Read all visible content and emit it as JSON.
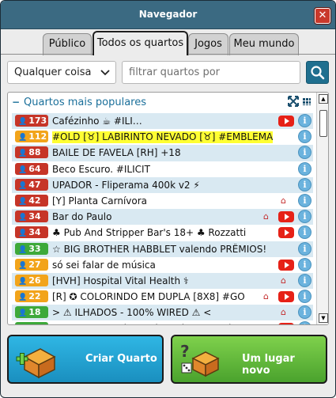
{
  "window": {
    "title": "Navegador",
    "close_label": "✕"
  },
  "tabs": [
    {
      "label": "Público",
      "active": false
    },
    {
      "label": "Todos os quartos",
      "active": true
    },
    {
      "label": "Jogos",
      "active": false
    },
    {
      "label": "Meu mundo",
      "active": false
    }
  ],
  "search": {
    "filter_selected": "Qualquer coisa",
    "placeholder": "filtrar quartos por"
  },
  "section": {
    "title": "Quartos mais populares",
    "collapse_symbol": "−"
  },
  "rooms": [
    {
      "count": "173",
      "status": "red",
      "name": "Cafézinho ☕ #ILI…",
      "youtube": true,
      "house": false
    },
    {
      "count": "112",
      "status": "orange",
      "name": "#OLD [♉] LABIRINTO NEVADO [♉] #EMBLEMA",
      "youtube": false,
      "house": false,
      "highlight": true
    },
    {
      "count": "88",
      "status": "red",
      "name": "BAILE DE FAVELA [RH] +18",
      "youtube": false,
      "house": false
    },
    {
      "count": "64",
      "status": "red",
      "name": "Beco Escuro.          #ILICIT",
      "youtube": false,
      "house": false
    },
    {
      "count": "47",
      "status": "red",
      "name": "UPADOR - Fliperama 400k v2 ⚡",
      "youtube": false,
      "house": false
    },
    {
      "count": "42",
      "status": "red",
      "name": "[Y] Planta Carnívora",
      "youtube": false,
      "house": true
    },
    {
      "count": "34",
      "status": "red",
      "name": "Bar do Paulo",
      "youtube": true,
      "house": true
    },
    {
      "count": "34",
      "status": "red",
      "name": "♣ Pub And Stripper Bar's 18+   ♣ Rozzatti",
      "youtube": true,
      "house": false
    },
    {
      "count": "33",
      "status": "green",
      "name": "☆ BIG BROTHER HABBLET valendo PRÊMIOS!",
      "youtube": false,
      "house": false
    },
    {
      "count": "27",
      "status": "orange",
      "name": "só sei falar de música",
      "youtube": true,
      "house": false
    },
    {
      "count": "26",
      "status": "orange",
      "name": "[HVH]    Hospital Vital Health ⚕",
      "youtube": false,
      "house": true
    },
    {
      "count": "22",
      "status": "orange",
      "name": "[R] ✪ COLORINDO EM DUPLA [8X8] #GO",
      "youtube": true,
      "house": true
    },
    {
      "count": "18",
      "status": "green",
      "name": "        > ⚠ ILHADOS   - 100% WIRED ⚠ <",
      "youtube": false,
      "house": true
    },
    {
      "count": "18",
      "status": "green",
      "name": "UPADOR - Cassino, Loja e Slots - #Cai…",
      "youtube": true,
      "house": true
    }
  ],
  "actions": {
    "create_label": "Criar Quarto",
    "random_label": "Um lugar novo"
  },
  "colors": {
    "titlebar": "#3b6a82",
    "accent": "#1a6f9a",
    "create": "#2fb6e4",
    "random": "#6cc443"
  }
}
